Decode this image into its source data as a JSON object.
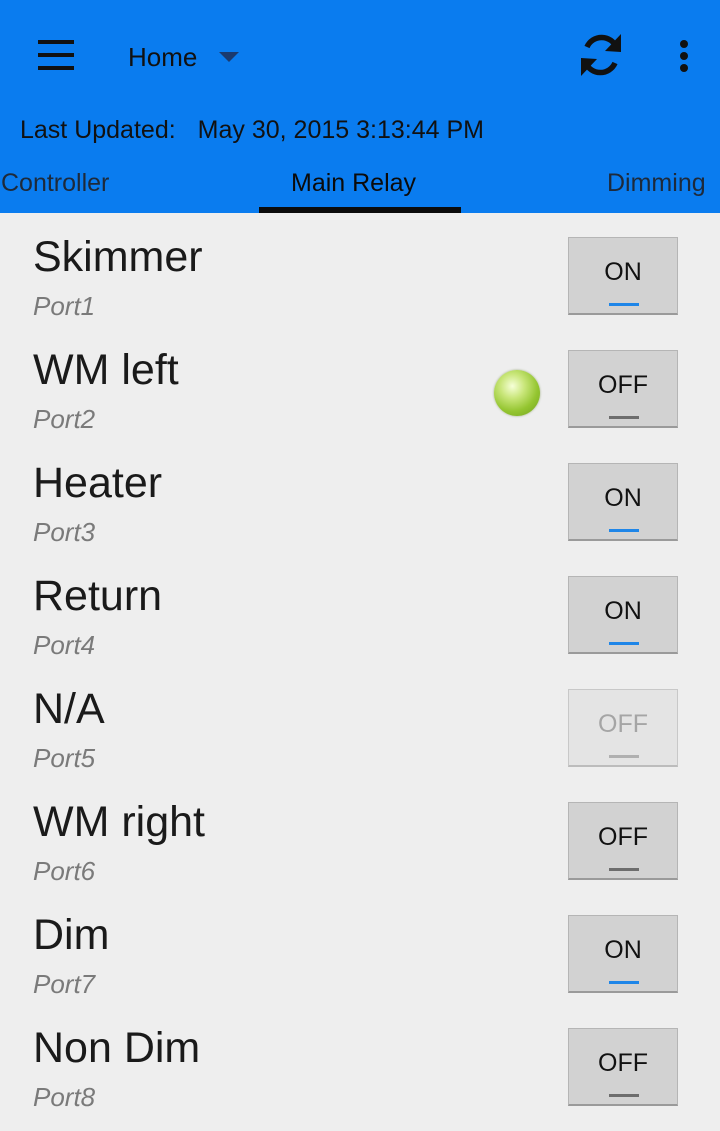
{
  "toolbar": {
    "spinner_label": "Home",
    "menu_icon": "hamburger-menu-icon",
    "refresh_icon": "refresh-icon",
    "overflow_icon": "more-vert-icon"
  },
  "status": {
    "last_updated_label": "Last Updated:",
    "last_updated_value": "May 30, 2015 3:13:44 PM"
  },
  "tabs": [
    {
      "label": "Controller",
      "active": false
    },
    {
      "label": "Main Relay",
      "active": true
    },
    {
      "label": "Dimming",
      "active": false
    }
  ],
  "ports": [
    {
      "name": "Skimmer",
      "port": "Port1",
      "state": "ON",
      "enabled": true,
      "indicator": false
    },
    {
      "name": "WM left",
      "port": "Port2",
      "state": "OFF",
      "enabled": true,
      "indicator": true
    },
    {
      "name": "Heater",
      "port": "Port3",
      "state": "ON",
      "enabled": true,
      "indicator": false
    },
    {
      "name": "Return",
      "port": "Port4",
      "state": "ON",
      "enabled": true,
      "indicator": false
    },
    {
      "name": "N/A",
      "port": "Port5",
      "state": "OFF",
      "enabled": false,
      "indicator": false
    },
    {
      "name": "WM right",
      "port": "Port6",
      "state": "OFF",
      "enabled": true,
      "indicator": false
    },
    {
      "name": "Dim",
      "port": "Port7",
      "state": "ON",
      "enabled": true,
      "indicator": false
    },
    {
      "name": "Non Dim",
      "port": "Port8",
      "state": "OFF",
      "enabled": true,
      "indicator": false
    }
  ],
  "colors": {
    "header_bg": "#0a7cef",
    "page_bg": "#eeeeee",
    "toggle_on_bar": "#1f86e8",
    "toggle_off_bar": "#6d6d6d",
    "indicator_led": "#94c530"
  }
}
